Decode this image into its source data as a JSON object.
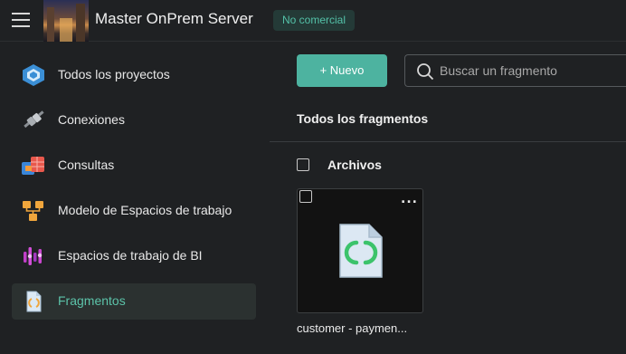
{
  "header": {
    "menu_icon": "hamburger-icon",
    "title": "Master OnPrem Server",
    "badge": "No comercial"
  },
  "sidebar": {
    "items": [
      {
        "label": "Todos los proyectos",
        "icon": "projects-icon"
      },
      {
        "label": "Conexiones",
        "icon": "plug-icon"
      },
      {
        "label": "Consultas",
        "icon": "queries-icon"
      },
      {
        "label": "Modelo de Espacios de trabajo",
        "icon": "workspace-model-icon"
      },
      {
        "label": "Espacios de trabajo de BI",
        "icon": "bi-workspaces-icon"
      },
      {
        "label": "Fragmentos",
        "icon": "fragment-icon",
        "active": true
      }
    ]
  },
  "toolbar": {
    "new_label": "+ Nuevo",
    "search_placeholder": "Buscar un fragmento"
  },
  "main": {
    "section_title": "Todos los fragmentos",
    "group_label": "Archivos",
    "cards": [
      {
        "caption": "customer - paymen...",
        "more_label": "...",
        "icon": "fragment-file-icon"
      }
    ]
  },
  "colors": {
    "accent": "#4db3a0",
    "active_text": "#5cc3a9",
    "badge_bg": "#243a37",
    "background": "#1f2123"
  }
}
